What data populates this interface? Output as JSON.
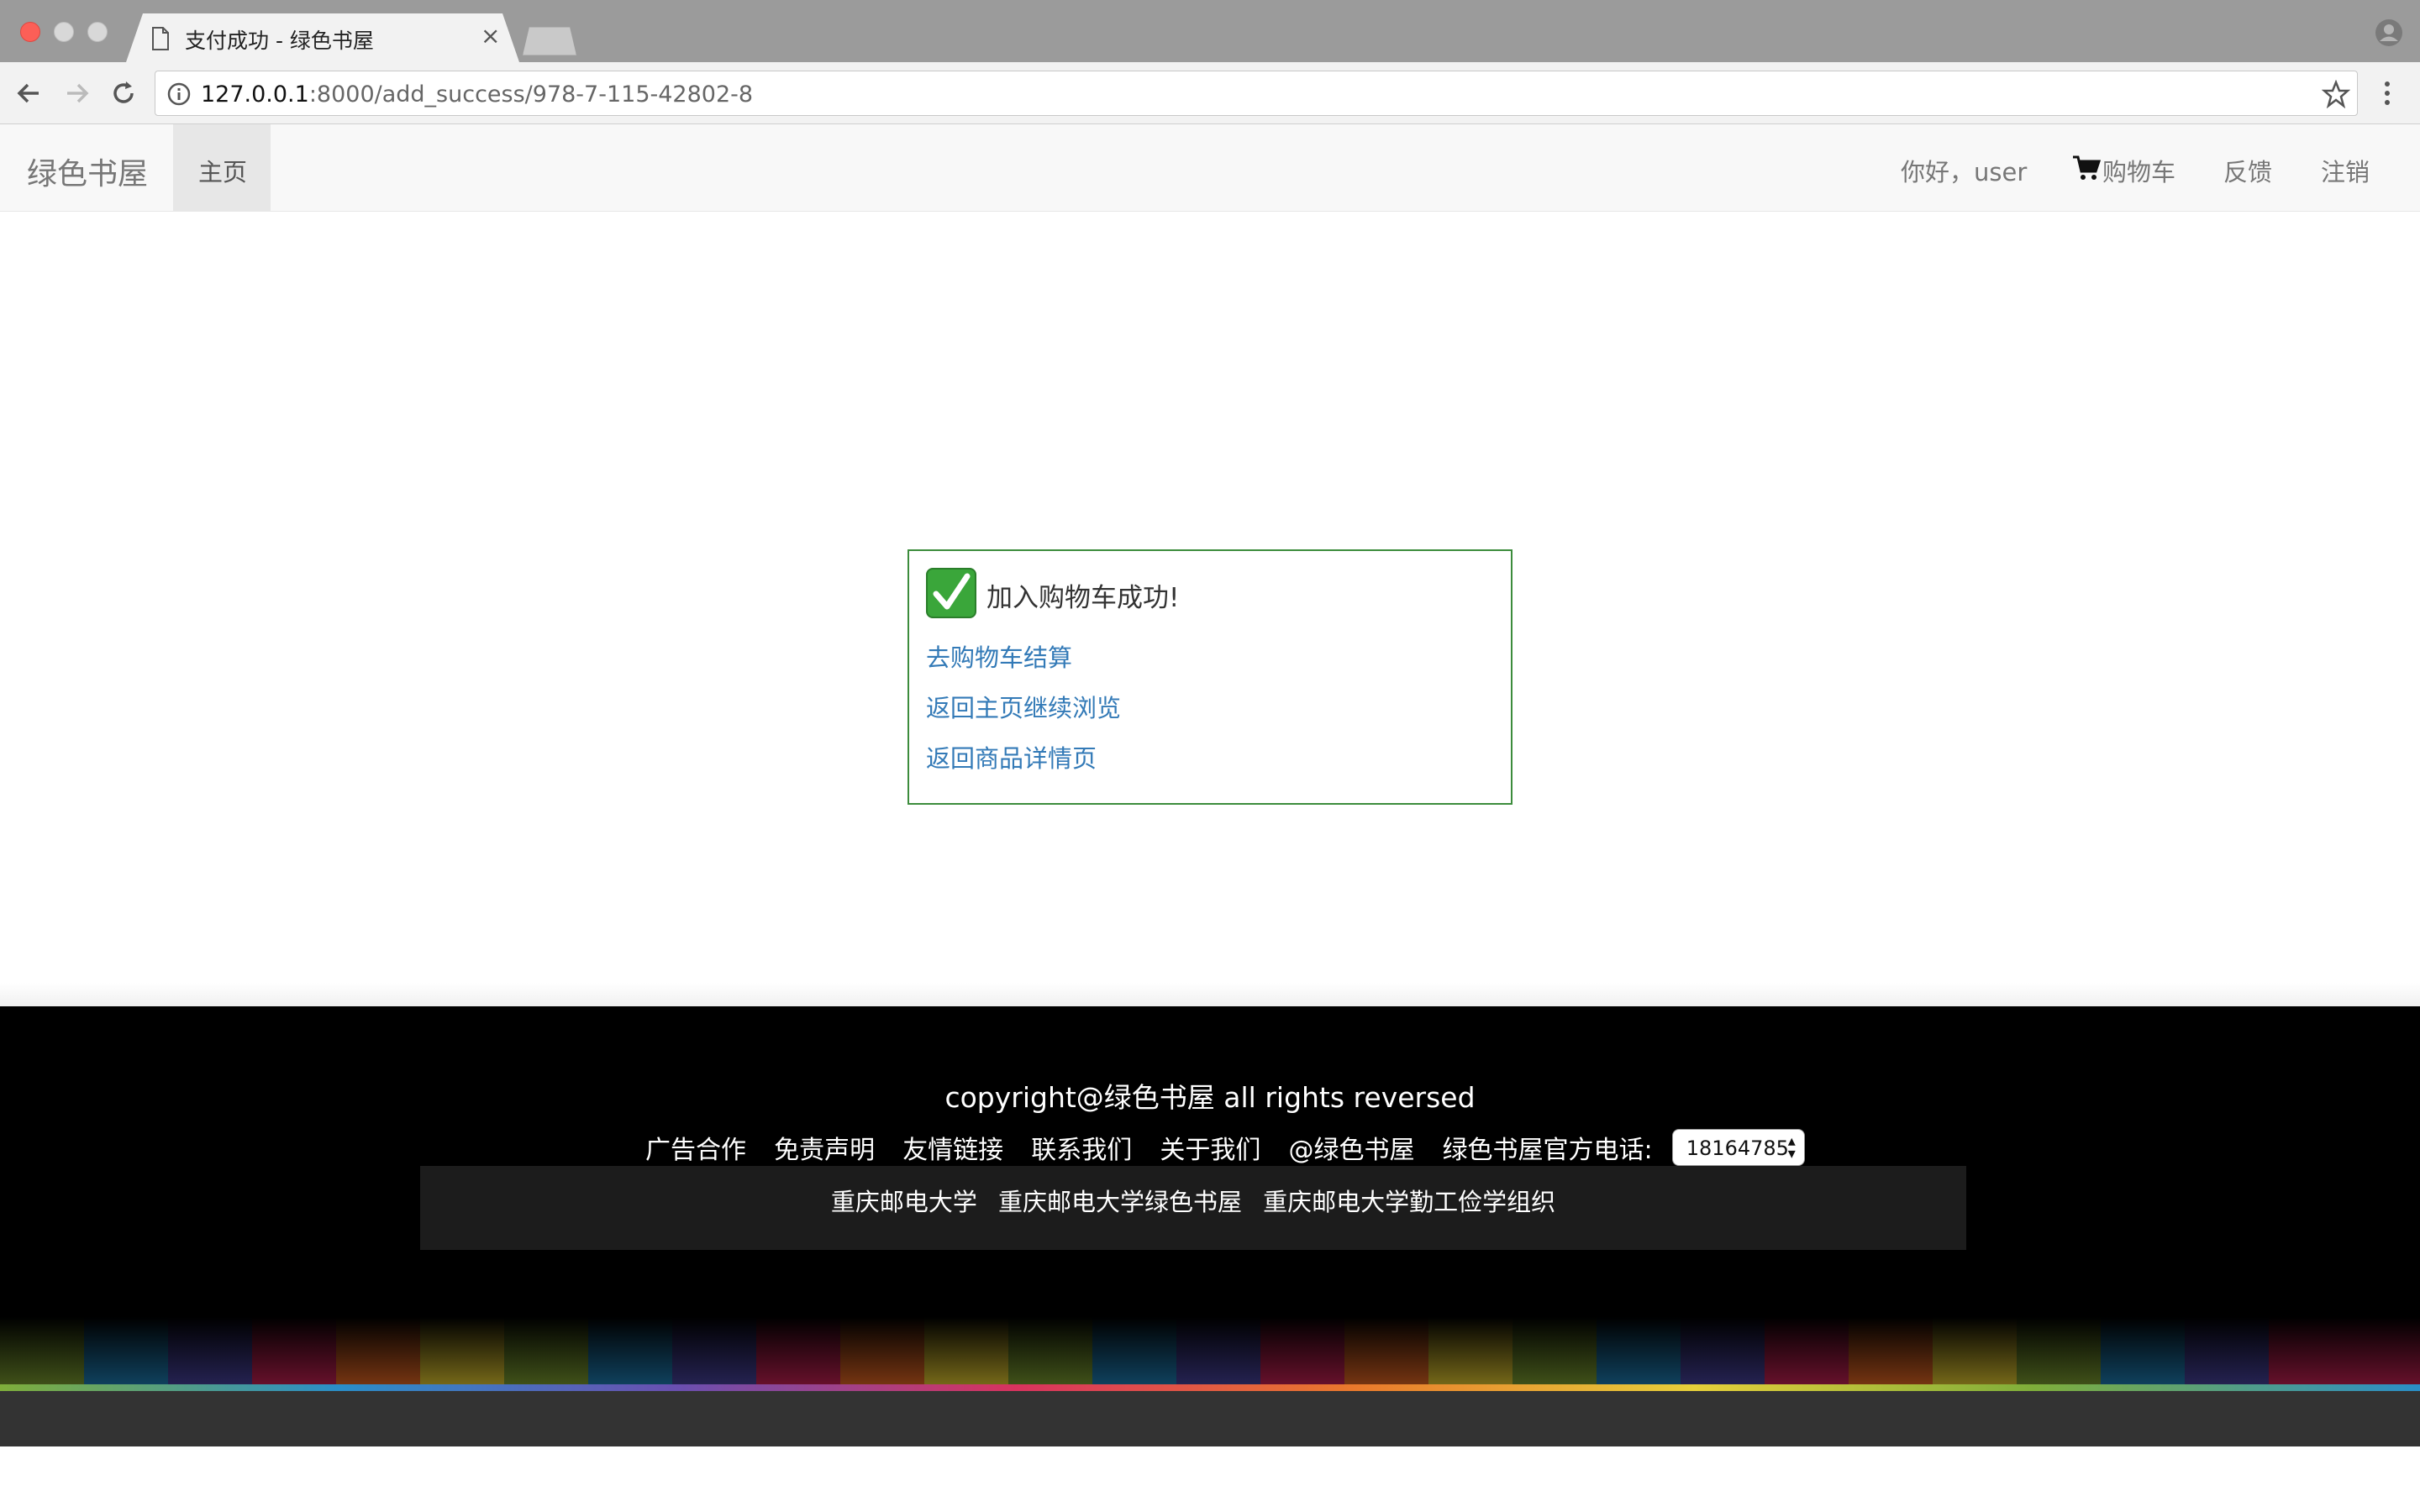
{
  "browser": {
    "tab_title": "支付成功 - 绿色书屋",
    "tab_close": "×",
    "url_host": "127.0.0.1",
    "url_rest": ":8000/add_success/978-7-115-42802-8"
  },
  "navbar": {
    "brand": "绿色书屋",
    "home": "主页",
    "greeting": "你好，user",
    "cart": "购物车",
    "feedback": "反馈",
    "logout": "注销"
  },
  "panel": {
    "title": "加入购物车成功!",
    "links": [
      "去购物车结算",
      "返回主页继续浏览",
      "返回商品详情页"
    ]
  },
  "footer": {
    "copyright": "copyright@绿色书屋 all rights reversed",
    "links": [
      "广告合作",
      "免责声明",
      "友情链接",
      "联系我们",
      "关于我们",
      "@绿色书屋"
    ],
    "phone_label": "绿色书屋官方电话:",
    "phone_value": "18164785",
    "bar_links": [
      "重庆邮电大学",
      "重庆邮电大学绿色书屋",
      "重庆邮电大学勤工俭学组织"
    ]
  },
  "colors": {
    "link": "#337ab7",
    "panel_border": "#3c8c3c",
    "check_green": "#3aa63a"
  },
  "icons": [
    "page-icon",
    "back-arrow-icon",
    "forward-arrow-icon",
    "reload-icon",
    "info-icon",
    "star-icon",
    "menu-icon",
    "profile-icon",
    "cart-icon",
    "check-icon"
  ]
}
